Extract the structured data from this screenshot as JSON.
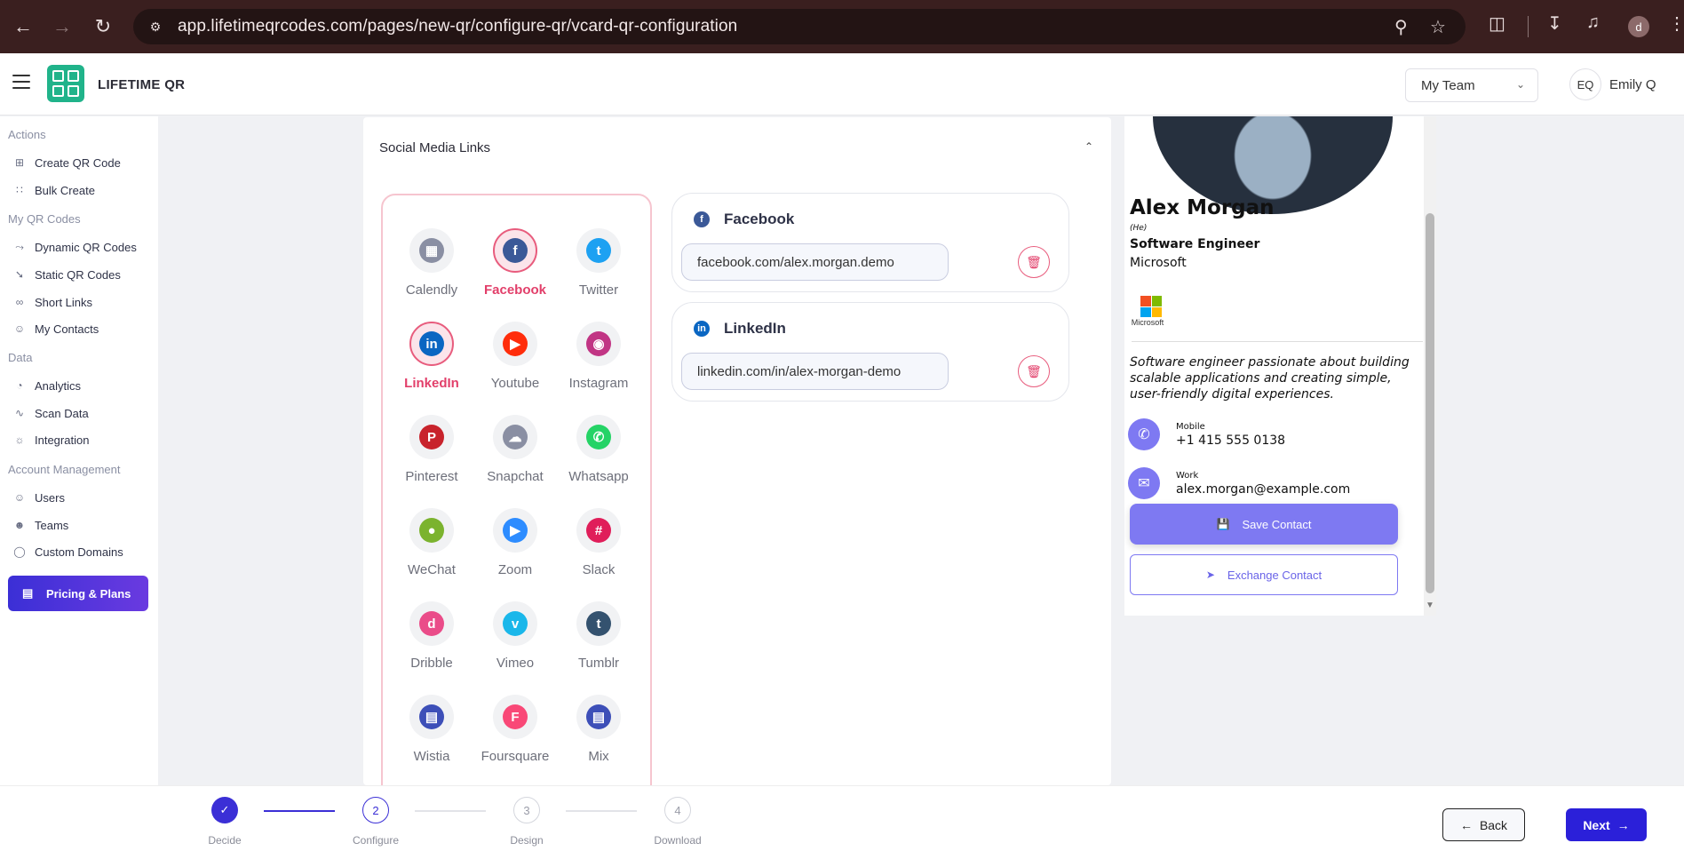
{
  "browser": {
    "url": "app.lifetimeqrcodes.com/pages/new-qr/configure-qr/vcard-qr-configuration",
    "profile_initial": "d"
  },
  "header": {
    "brand": "LIFETIME QR",
    "team_select": "My Team",
    "user_initials": "EQ",
    "user_name": "Emily Q"
  },
  "sidebar": {
    "sections": {
      "actions": "Actions",
      "my_qr_codes": "My QR Codes",
      "data": "Data",
      "account": "Account Management"
    },
    "items": {
      "create": "Create QR Code",
      "bulk": "Bulk Create",
      "dynamic": "Dynamic QR Codes",
      "static": "Static QR Codes",
      "short": "Short Links",
      "contacts": "My Contacts",
      "analytics": "Analytics",
      "scan": "Scan Data",
      "integration": "Integration",
      "users": "Users",
      "teams": "Teams",
      "domains": "Custom Domains"
    },
    "pricing": "Pricing & Plans"
  },
  "main": {
    "section_title": "Social Media Links",
    "platforms": [
      {
        "label": "Calendly",
        "icon": "calendly-icon",
        "color": "#8a8fa3",
        "selected": false
      },
      {
        "label": "Facebook",
        "icon": "facebook-icon",
        "color": "#3b5998",
        "selected": true
      },
      {
        "label": "Twitter",
        "icon": "twitter-icon",
        "color": "#1da1f2",
        "selected": false
      },
      {
        "label": "LinkedIn",
        "icon": "linkedin-icon",
        "color": "#0a66c2",
        "selected": true
      },
      {
        "label": "Youtube",
        "icon": "youtube-icon",
        "color": "#ff2d0b",
        "selected": false
      },
      {
        "label": "Instagram",
        "icon": "instagram-icon",
        "color": "#c13584",
        "selected": false
      },
      {
        "label": "Pinterest",
        "icon": "pinterest-icon",
        "color": "#c8232c",
        "selected": false
      },
      {
        "label": "Snapchat",
        "icon": "snapchat-icon",
        "color": "#8a8fa3",
        "selected": false
      },
      {
        "label": "Whatsapp",
        "icon": "whatsapp-icon",
        "color": "#25d366",
        "selected": false
      },
      {
        "label": "WeChat",
        "icon": "wechat-icon",
        "color": "#7bb32e",
        "selected": false
      },
      {
        "label": "Zoom",
        "icon": "zoom-icon",
        "color": "#2d8cff",
        "selected": false
      },
      {
        "label": "Slack",
        "icon": "slack-icon",
        "color": "#e01e5a",
        "selected": false
      },
      {
        "label": "Dribble",
        "icon": "dribbble-icon",
        "color": "#ea4c89",
        "selected": false
      },
      {
        "label": "Vimeo",
        "icon": "vimeo-icon",
        "color": "#1ab7ea",
        "selected": false
      },
      {
        "label": "Tumblr",
        "icon": "tumblr-icon",
        "color": "#34526f",
        "selected": false
      },
      {
        "label": "Wistia",
        "icon": "wistia-icon",
        "color": "#3d4fb8",
        "selected": false
      },
      {
        "label": "Foursquare",
        "icon": "foursquare-icon",
        "color": "#f94877",
        "selected": false
      },
      {
        "label": "Mix",
        "icon": "mix-icon",
        "color": "#3d4fb8",
        "selected": false
      }
    ],
    "links": [
      {
        "label": "Facebook",
        "value": "facebook.com/alex.morgan.demo",
        "color": "#3b5998"
      },
      {
        "label": "LinkedIn",
        "value": "linkedin.com/in/alex-morgan-demo",
        "color": "#0a66c2"
      }
    ]
  },
  "preview": {
    "name": "Alex Morgan",
    "pronoun": "(He)",
    "title": "Software Engineer",
    "company": "Microsoft",
    "logo_caption": "Microsoft",
    "bio": "Software engineer passionate about building scalable applications and creating simple, user-friendly digital experiences.",
    "mobile_label": "Mobile",
    "mobile": "+1 415 555 0138",
    "work_label": "Work",
    "email": "alex.morgan@example.com",
    "save_button": "Save Contact",
    "exchange_button": "Exchange Contact",
    "accent": "#7e79f2"
  },
  "stepper": {
    "steps": [
      {
        "num": "",
        "label": "Decide",
        "state": "done"
      },
      {
        "num": "2",
        "label": "Configure",
        "state": "active"
      },
      {
        "num": "3",
        "label": "Design",
        "state": "todo"
      },
      {
        "num": "4",
        "label": "Download",
        "state": "todo"
      }
    ],
    "back": "Back",
    "next": "Next"
  }
}
